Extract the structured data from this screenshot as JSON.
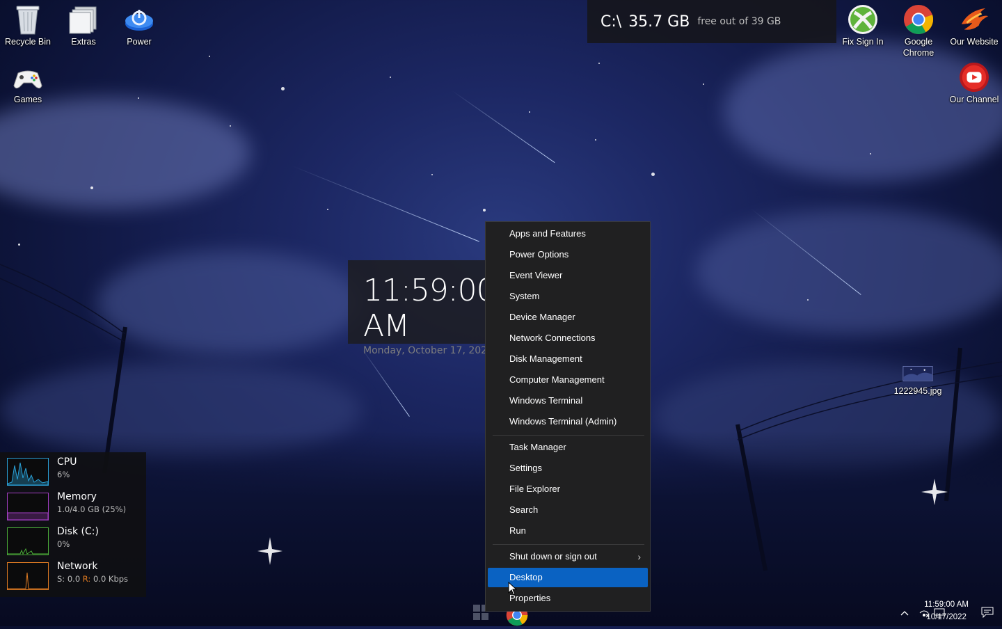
{
  "desktop_icons": {
    "recycle_bin": "Recycle Bin",
    "extras": "Extras",
    "power": "Power",
    "games": "Games",
    "fix_sign_in": "Fix Sign In",
    "google_chrome_line1": "Google",
    "google_chrome_line2": "Chrome",
    "our_website": "Our Website",
    "our_channel": "Our Channel",
    "image_file": "1222945.jpg"
  },
  "disk_widget": {
    "drive": "C:\\",
    "size": "35.7 GB",
    "free_text": "free out of 39 GB"
  },
  "clock_widget": {
    "time": "11:59:00 AM",
    "date": "Monday, October 17, 2022"
  },
  "perf_widget": {
    "cpu": {
      "label": "CPU",
      "value": "6%",
      "color": "#2aa1d8"
    },
    "memory": {
      "label": "Memory",
      "value": "1.0/4.0 GB (25%)",
      "color": "#a43fc4"
    },
    "disk": {
      "label": "Disk (C:)",
      "value": "0%",
      "color": "#4caf3a"
    },
    "network": {
      "label": "Network",
      "send_label": "S:",
      "send_value": "0.0",
      "recv_label": "R:",
      "recv_value": "0.0 Kbps",
      "color": "#e07b22"
    }
  },
  "context_menu": {
    "items": [
      "Apps and Features",
      "Power Options",
      "Event Viewer",
      "System",
      "Device Manager",
      "Network Connections",
      "Disk Management",
      "Computer Management",
      "Windows Terminal",
      "Windows Terminal (Admin)",
      "Task Manager",
      "Settings",
      "File Explorer",
      "Search",
      "Run",
      "Shut down or sign out",
      "Desktop",
      "Properties"
    ],
    "highlighted": "Desktop",
    "highlight_color": "#0a62c2"
  },
  "tray": {
    "time": "11:59:00 AM",
    "date": "10/17/2022"
  }
}
